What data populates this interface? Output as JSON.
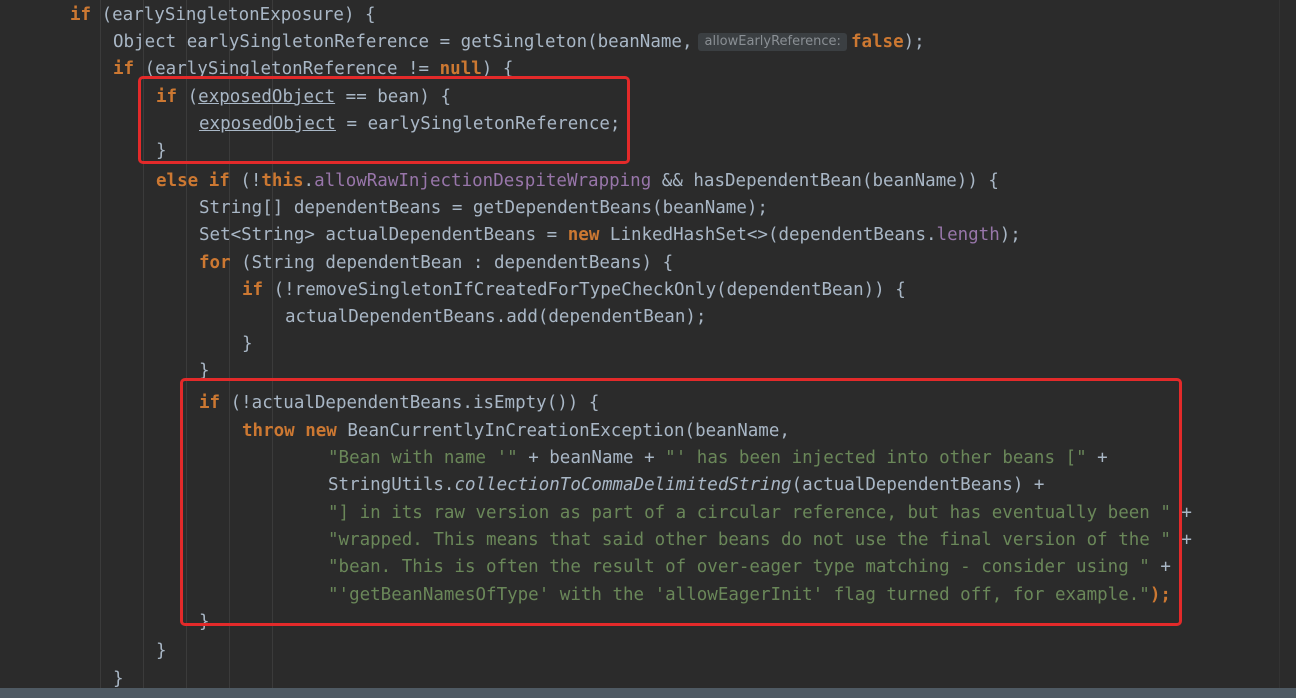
{
  "code": {
    "l1": {
      "kw_if": "if",
      "rest": " (earlySingletonExposure) {"
    },
    "l2": {
      "a": "Object earlySingletonReference = getSingleton(beanName,",
      "hint": "allowEarlyReference:",
      "kw_false": "false",
      "end": ");"
    },
    "l3": {
      "kw_if": "if",
      "a": " (earlySingletonReference != ",
      "kw_null": "null",
      "b": ") {"
    },
    "l4": {
      "kw_if": "if",
      "a": " (",
      "var": "exposedObject",
      "b": " == bean) {"
    },
    "l5": {
      "var": "exposedObject",
      "a": " = earlySingletonReference;"
    },
    "l6": {
      "a": "}"
    },
    "l7": {
      "kw_else": "else",
      "kw_if": "if",
      "a": " (!",
      "kw_this": "this",
      "dot": ".",
      "field": "allowRawInjectionDespiteWrapping",
      "b": " && hasDependentBean(beanName)) {"
    },
    "l8": {
      "a": "String[] dependentBeans = getDependentBeans(beanName);"
    },
    "l9": {
      "a": "Set<String> actualDependentBeans = ",
      "kw_new": "new",
      "b": " LinkedHashSet<>(dependentBeans.",
      "field": "length",
      "c": ");"
    },
    "l10": {
      "kw_for": "for",
      "a": " (String dependentBean : dependentBeans) {"
    },
    "l11": {
      "kw_if": "if",
      "a": " (!removeSingletonIfCreatedForTypeCheckOnly(dependentBean)) {"
    },
    "l12": {
      "a": "actualDependentBeans.add(dependentBean);"
    },
    "l13": {
      "a": "}"
    },
    "l14": {
      "a": "}"
    },
    "l15": {
      "kw_if": "if",
      "a": " (!actualDependentBeans.isEmpty()) {"
    },
    "l16": {
      "kw_throw": "throw",
      "kw_new": "new",
      "a": " BeanCurrentlyInCreationException(beanName,"
    },
    "l17": {
      "s1": "\"Bean with name '\"",
      "a": " + beanName + ",
      "s2": "\"' has been injected into other beans [\"",
      "b": " +"
    },
    "l18": {
      "a": "StringUtils.",
      "ital": "collectionToCommaDelimitedString",
      "b": "(actualDependentBeans) +"
    },
    "l19": {
      "s": "\"] in its raw version as part of a circular reference, but has eventually been \"",
      "b": " +"
    },
    "l20": {
      "s": "\"wrapped. This means that said other beans do not use the final version of the \"",
      "b": " +"
    },
    "l21": {
      "s": "\"bean. This is often the result of over-eager type matching - consider using \"",
      "b": " +"
    },
    "l22": {
      "s": "\"'getBeanNamesOfType' with the 'allowEagerInit' flag turned off, for example.\"",
      "b": ");"
    },
    "l23": {
      "a": "}"
    },
    "l24": {
      "a": "}"
    },
    "l25": {
      "a": "}"
    }
  },
  "colors": {
    "background": "#2b2b2b",
    "keyword": "#cc7832",
    "string": "#6a8759",
    "field": "#9876aa",
    "plain": "#a9b7c6",
    "highlight_box": "#e32a2a"
  }
}
